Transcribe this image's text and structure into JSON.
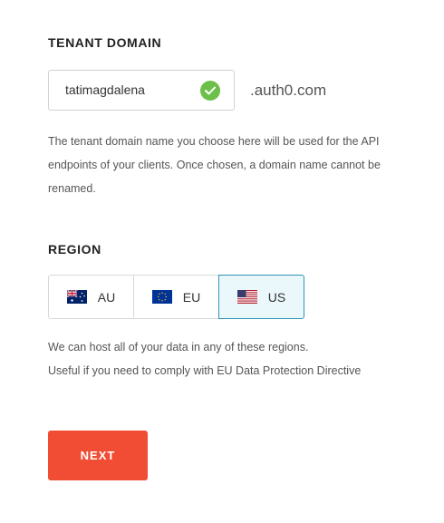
{
  "tenant": {
    "title": "TENANT DOMAIN",
    "domain_value": "tatimagdalena",
    "domain_suffix": ".auth0.com",
    "valid_icon": "check-circle-icon",
    "help": "The tenant domain name you choose here will be used for the API endpoints of your clients. Once chosen, a domain name cannot be renamed."
  },
  "region": {
    "title": "REGION",
    "options": [
      {
        "label": "AU",
        "flag": "australia-flag-icon",
        "selected": false
      },
      {
        "label": "EU",
        "flag": "eu-flag-icon",
        "selected": false
      },
      {
        "label": "US",
        "flag": "us-flag-icon",
        "selected": true
      }
    ],
    "help_line1": "We can host all of your data in any of these regions.",
    "help_line2": "Useful if you need to comply with EU Data Protection Directive"
  },
  "actions": {
    "next_label": "NEXT"
  },
  "colors": {
    "primary": "#f04d34",
    "valid": "#6cc04a",
    "selected_border": "#2e95b7",
    "selected_bg": "#eaf7fb"
  }
}
